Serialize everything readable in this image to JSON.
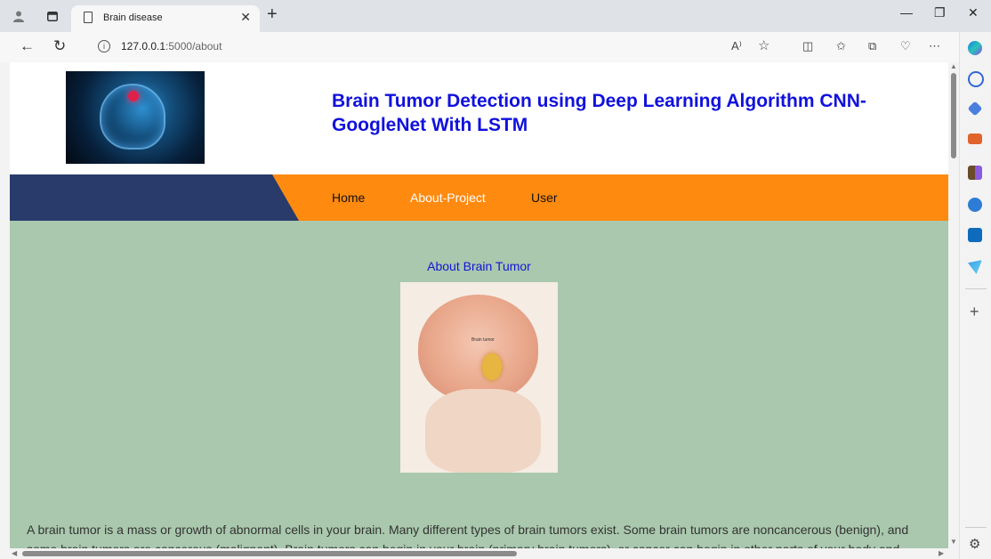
{
  "browser": {
    "tab_title": "Brain disease",
    "url_host": "127.0.0.1",
    "url_rest": ":5000/about",
    "read_aloud_glyph": "A⁾"
  },
  "site": {
    "title": "Brain Tumor Detection using Deep Learning Algorithm CNN-GoogleNet With LSTM",
    "nav": [
      {
        "label": "Home"
      },
      {
        "label": "About-Project"
      },
      {
        "label": "User"
      }
    ]
  },
  "content": {
    "heading": "About Brain Tumor",
    "image_label": "Brain tumor",
    "paragraph": "A brain tumor is a mass or growth of abnormal cells in your brain. Many different types of brain tumors exist. Some brain tumors are noncancerous (benign), and some brain tumors are cancerous (malignant). Brain tumors can begin in your brain (primary brain tumors), or cancer can begin in other parts of your body and spread to your brain as secondary (metastatic) brain tumors."
  },
  "colors": {
    "nav_orange": "#ff8a10",
    "nav_navy": "#283b6a",
    "content_bg": "#a9c8ad",
    "title_blue": "#1111dd"
  }
}
